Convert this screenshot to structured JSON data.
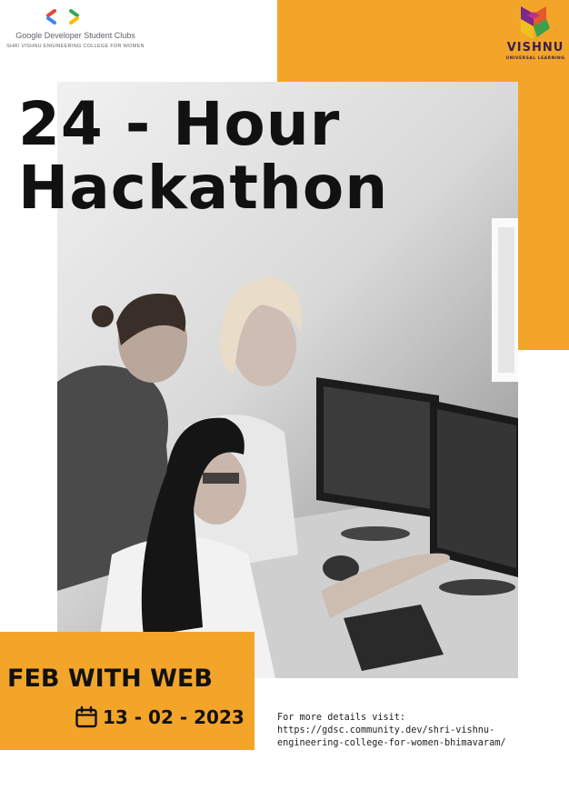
{
  "branding": {
    "gdsc_name": "Google Developer Student Clubs",
    "gdsc_college": "Shri Vishnu Engineering College for Women",
    "vishnu_name": "VISHNU",
    "vishnu_tagline": "UNIVERSAL LEARNING"
  },
  "headline": {
    "line1": "24 - Hour",
    "line2": "Hackathon"
  },
  "event": {
    "name": "FEB WITH WEB",
    "date": "13 - 02 - 2023"
  },
  "details": {
    "label": "For more details visit:",
    "url_line1": "https://gdsc.community.dev/shri-vishnu-",
    "url_line2": "engineering-college-for-women-bhimavaram/"
  },
  "colors": {
    "accent": "#F3A52A",
    "text": "#111111",
    "vishnu_purple": "#3a1f4d"
  },
  "icons": [
    "gdsc-logo-icon",
    "vishnu-logo-icon",
    "calendar-icon"
  ]
}
